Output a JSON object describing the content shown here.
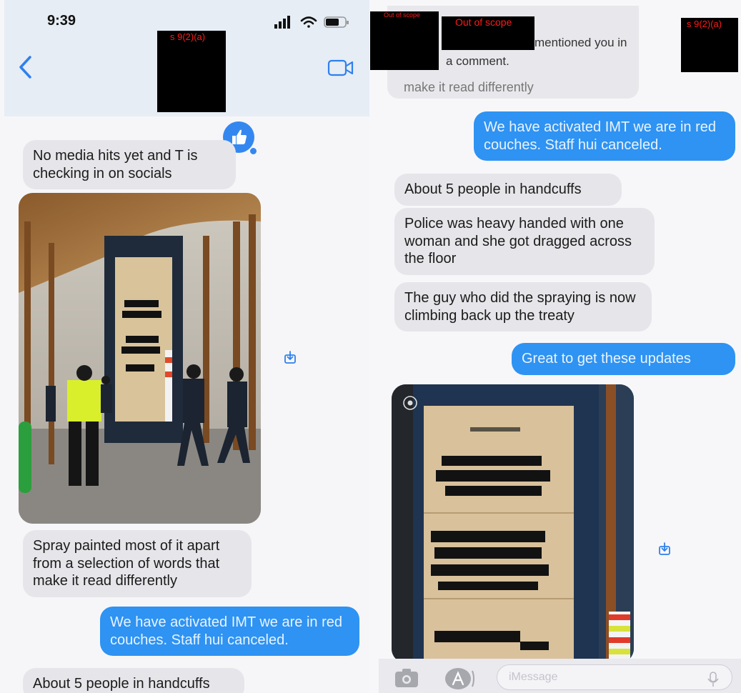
{
  "status_bar": {
    "time": "9:39"
  },
  "redactions": {
    "contact_name": "s 9(2)(a)",
    "top_left_small": "Out of scope",
    "top_middle": "Out of scope",
    "top_right": "s 9(2)(a)"
  },
  "notification": {
    "line1": "mentioned you in",
    "line2": "a comment."
  },
  "left_messages": {
    "msg1": "No media hits yet and T is checking in on socials",
    "msg2": "Spray painted most of it apart from a selection of words that make it read differently",
    "msg3": "We have activated IMT we are in red couches. Staff hui canceled.",
    "msg4_partial": "About 5 people in handcuffs"
  },
  "right_messages": {
    "partial_top": "make it read differently",
    "msg1": "We have activated IMT we are in red couches. Staff hui canceled.",
    "msg2": "About 5 people in handcuffs",
    "msg3": "Police was heavy handed with one woman and she got dragged across the floor",
    "msg4": "The guy who did the spraying is now climbing back up the treaty",
    "msg5": "Great to get these updates"
  },
  "compose": {
    "placeholder": "iMessage"
  },
  "icons": [
    "back-chevron-icon",
    "video-call-icon",
    "signal-icon",
    "wifi-icon",
    "battery-icon",
    "thumbs-up-icon",
    "share-icon",
    "camera-icon",
    "app-store-icon",
    "mic-icon",
    "live-photo-icon"
  ],
  "colors": {
    "outgoing": "#2e93f2",
    "incoming": "#e6e6ea",
    "header": "#e6edf5",
    "redaction_label": "#ff1a1a"
  }
}
